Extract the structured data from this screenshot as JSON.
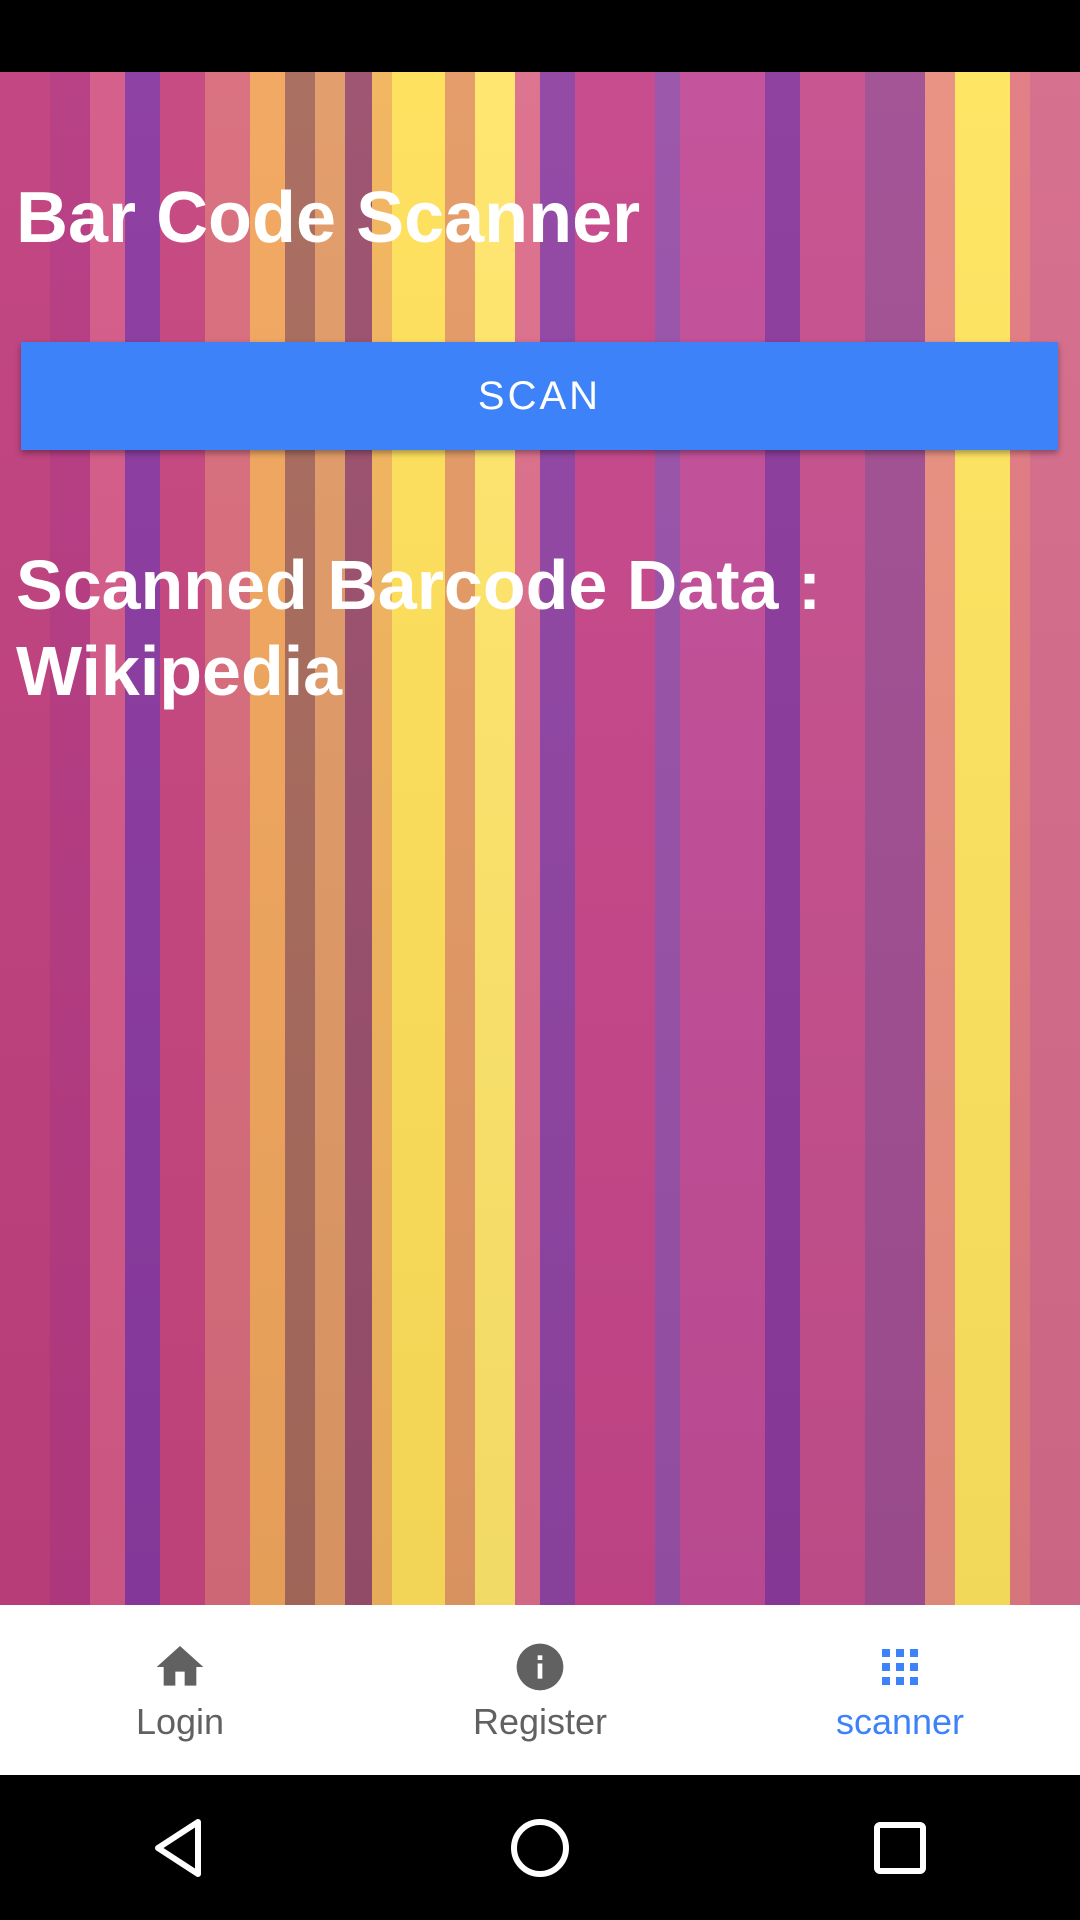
{
  "screen": {
    "title": "Bar Code Scanner",
    "scan_button_label": "SCAN",
    "result_text": "Scanned Barcode Data : Wikipedia"
  },
  "bottom_nav": {
    "items": [
      {
        "label": "Login",
        "icon": "home-icon",
        "active": false
      },
      {
        "label": "Register",
        "icon": "info-icon",
        "active": false
      },
      {
        "label": "scanner",
        "icon": "apps-grid-icon",
        "active": true
      }
    ]
  },
  "system_nav": {
    "buttons": [
      "back-icon",
      "home-circle-icon",
      "recents-square-icon"
    ]
  },
  "colors": {
    "accent": "#3d82f8",
    "inactive_nav": "#616161",
    "nav_background": "#ffffff",
    "text_on_background": "#ffffff"
  }
}
